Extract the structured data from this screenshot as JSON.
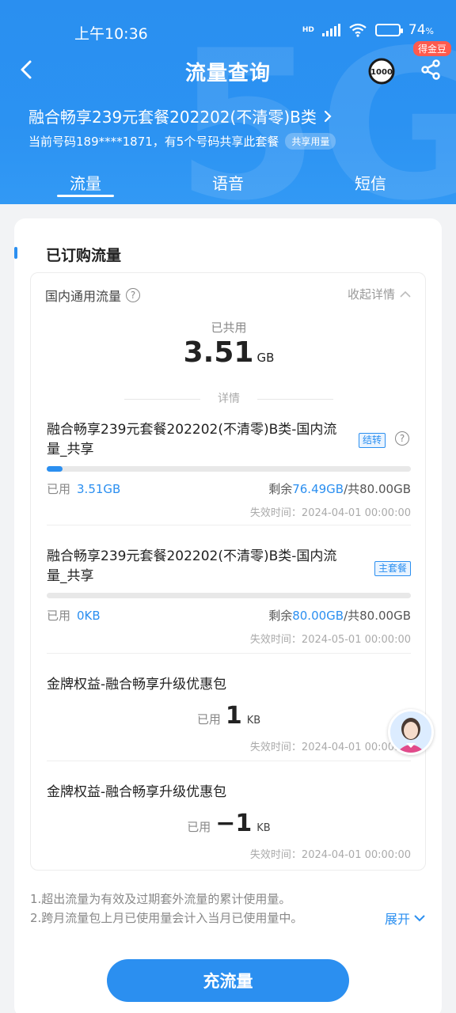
{
  "status": {
    "time": "上午10:36",
    "hd": "HD",
    "battery_pct": "74",
    "battery_unit": "%",
    "battery_level": 0.74
  },
  "nav": {
    "title": "流量查询",
    "badge": "得金豆",
    "service_icon": "1000-icon",
    "share_icon": "share-icon",
    "back_icon": "chevron-left-icon"
  },
  "plan": {
    "name": "融合畅享239元套餐202202(不清零)B类",
    "subtitle": "当前号码189****1871，有5个号码共享此套餐",
    "share_tag": "共享用量"
  },
  "tabs": [
    {
      "label": "流量",
      "active": true
    },
    {
      "label": "语音",
      "active": false
    },
    {
      "label": "短信",
      "active": false
    }
  ],
  "section": {
    "title": "已订购流量",
    "group_title": "国内通用流量",
    "collapse_label": "收起详情",
    "shared_label": "已共用",
    "shared_value": "3.51",
    "shared_unit": "GB",
    "detail_label": "详情"
  },
  "items": [
    {
      "title": "融合畅享239元套餐202202(不清零)B类-国内流量_共享",
      "tag": "结转",
      "used_label": "已用",
      "used_value": "3.51GB",
      "remain_prefix": "剩余",
      "remain_value": "76.49GB",
      "total": "/共80.00GB",
      "used_fraction": 0.044,
      "expire": "失效时间：2024-04-01 00:00:00"
    },
    {
      "title": "融合畅享239元套餐202202(不清零)B类-国内流量_共享",
      "tag": "主套餐",
      "used_label": "已用",
      "used_value": "0KB",
      "remain_prefix": "剩余",
      "remain_value": "80.00GB",
      "total": "/共80.00GB",
      "used_fraction": 0,
      "expire": "失效时间：2024-05-01 00:00:00"
    },
    {
      "title": "金牌权益-融合畅享升级优惠包",
      "used_label": "已用",
      "used_value": "1",
      "used_unit": "KB",
      "expire": "失效时间：2024-04-01 00:00:00"
    },
    {
      "title": "金牌权益-融合畅享升级优惠包",
      "used_label": "已用",
      "used_value": "−1",
      "used_unit": "KB",
      "expire": "失效时间：2024-04-01 00:00:00"
    }
  ],
  "notes": {
    "line1": "1.超出流量为有效及过期套外流量的累计使用量。",
    "line2": "2.跨月流量包上月已使用量会计入当月已使用量中。",
    "expand_label": "展开"
  },
  "recharge_label": "充流量",
  "colors": {
    "accent": "#2b8ff0",
    "header": "#2a8ff0",
    "badge": "#ff5a4e"
  }
}
